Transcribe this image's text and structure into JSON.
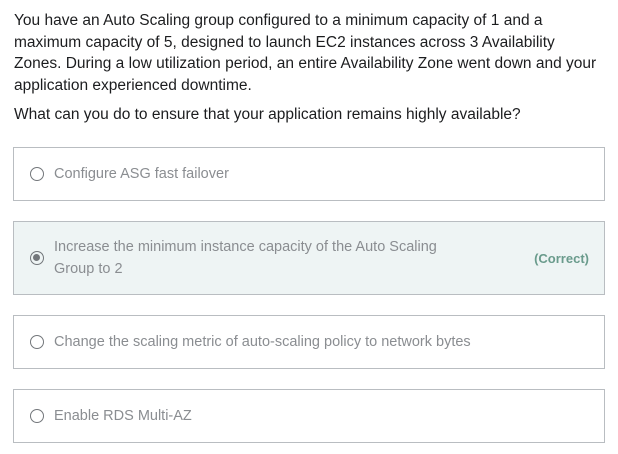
{
  "question": "You have an Auto Scaling group configured to a minimum capacity of 1 and a maximum capacity of 5, designed to launch EC2 instances across 3 Availability Zones. During a low utilization period, an entire Availability Zone went down and your application experienced downtime.",
  "prompt": "What can you do to ensure that your application remains highly available?",
  "options": [
    {
      "label": "Configure ASG fast failover"
    },
    {
      "label": "Increase the minimum instance capacity of the Auto Scaling Group to 2",
      "tag": "(Correct)"
    },
    {
      "label": "Change the scaling metric of auto-scaling policy to network bytes"
    },
    {
      "label": "Enable RDS Multi-AZ"
    }
  ]
}
